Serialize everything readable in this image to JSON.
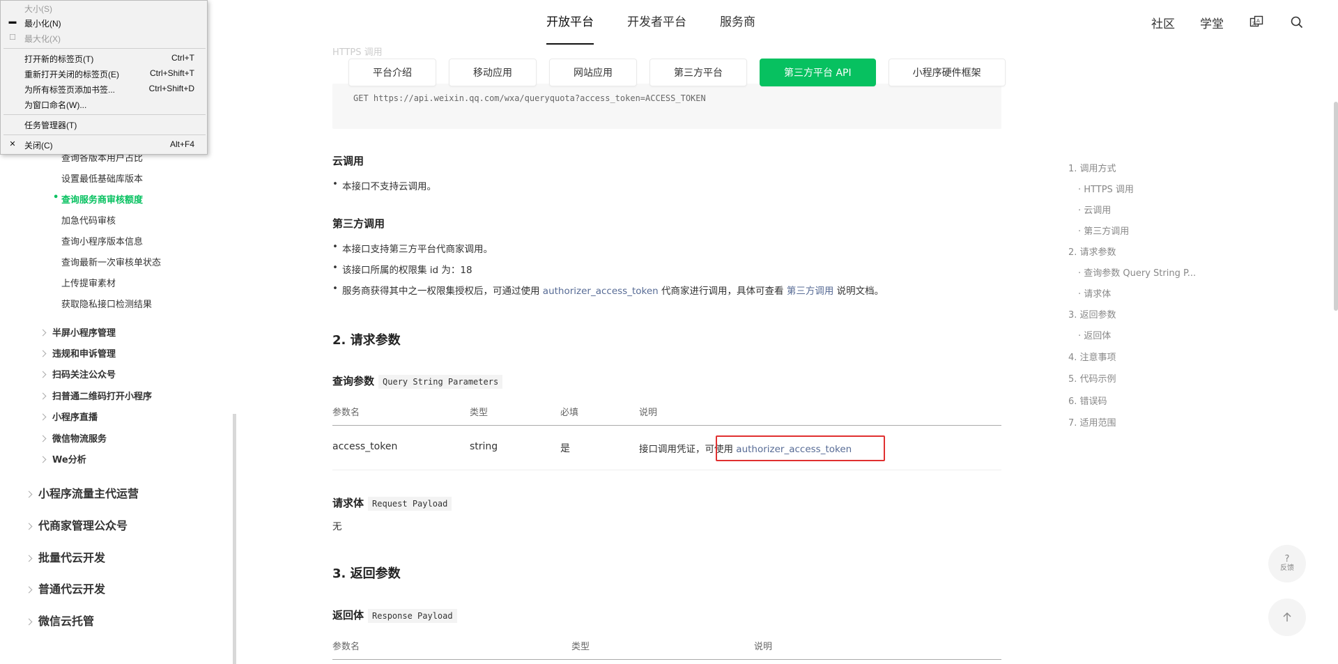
{
  "topnav": {
    "items": [
      "开放平台",
      "开发者平台",
      "服务商"
    ],
    "right": {
      "community": "社区",
      "academy": "学堂"
    }
  },
  "subtabs": [
    "平台介绍",
    "移动应用",
    "网站应用",
    "第三方平台",
    "第三方平台 API",
    "小程序硬件框架"
  ],
  "sidebar": {
    "l3_items": [
      "查询各版本用户占比",
      "设置最低基础库版本",
      "查询服务商审核额度",
      "加急代码审核",
      "查询小程序版本信息",
      "查询最新一次审核单状态",
      "上传提审素材",
      "获取隐私接口检测结果"
    ],
    "l2_items": [
      "半屏小程序管理",
      "违规和申诉管理",
      "扫码关注公众号",
      "扫普通二维码打开小程序",
      "小程序直播",
      "微信物流服务",
      "We分析"
    ],
    "l1_items": [
      "小程序流量主代运营",
      "代商家管理公众号",
      "批量代云开发",
      "普通代云开发",
      "微信云托管"
    ]
  },
  "main": {
    "code_heading": "HTTPS 调用",
    "code_line": "GET https://api.weixin.qq.com/wxa/queryquota?access_token=ACCESS_TOKEN",
    "cloud": {
      "title": "云调用",
      "bullet": "本接口不支持云调用。"
    },
    "third": {
      "title": "第三方调用",
      "b1": "本接口支持第三方平台代商家调用。",
      "b2": "该接口所属的权限集 id 为：18",
      "b3_pre": "服务商获得其中之一权限集授权后，可通过使用 ",
      "b3_link1": "authorizer_access_token",
      "b3_mid": " 代商家进行调用，具体可查看 ",
      "b3_link2": "第三方调用",
      "b3_post": " 说明文档。"
    },
    "req": {
      "title": "2. 请求参数",
      "query_title": "查询参数",
      "query_code": "Query String Parameters",
      "headers": [
        "参数名",
        "类型",
        "必填",
        "说明"
      ],
      "row": {
        "name": "access_token",
        "type": "string",
        "required": "是",
        "desc_pre": "接口调用凭证，可使用 ",
        "desc_link": "authorizer_access_token"
      },
      "body_title": "请求体",
      "body_code": "Request Payload",
      "body_value": "无"
    },
    "resp": {
      "title": "3. 返回参数",
      "body_title": "返回体",
      "body_code": "Response Payload",
      "headers": [
        "参数名",
        "类型",
        "说明"
      ]
    }
  },
  "toc": {
    "items": [
      "1. 调用方式",
      "· HTTPS 调用",
      "· 云调用",
      "· 第三方调用",
      "2. 请求参数",
      "· 查询参数 Query String P...",
      "· 请求体",
      "3. 返回参数",
      "· 返回体",
      "4. 注意事项",
      "5. 代码示例",
      "6. 错误码",
      "7. 适用范围"
    ]
  },
  "float": {
    "feedback_q": "?",
    "feedback_label": "反馈"
  },
  "context_menu": {
    "items": [
      {
        "label": "大小(S)",
        "shortcut": ""
      },
      {
        "label": "最小化(N)",
        "shortcut": ""
      },
      {
        "label": "最大化(X)",
        "shortcut": ""
      },
      {
        "label": "打开新的标签页(T)",
        "shortcut": "Ctrl+T"
      },
      {
        "label": "重新打开关闭的标签页(E)",
        "shortcut": "Ctrl+Shift+T"
      },
      {
        "label": "为所有标签页添加书签...",
        "shortcut": "Ctrl+Shift+D"
      },
      {
        "label": "为窗口命名(W)...",
        "shortcut": ""
      },
      {
        "label": "任务管理器(T)",
        "shortcut": ""
      },
      {
        "label": "关闭(C)",
        "shortcut": "Alt+F4"
      }
    ]
  },
  "colors": {
    "accent": "#07c160",
    "link": "#576b95",
    "highlight": "#e03030"
  }
}
